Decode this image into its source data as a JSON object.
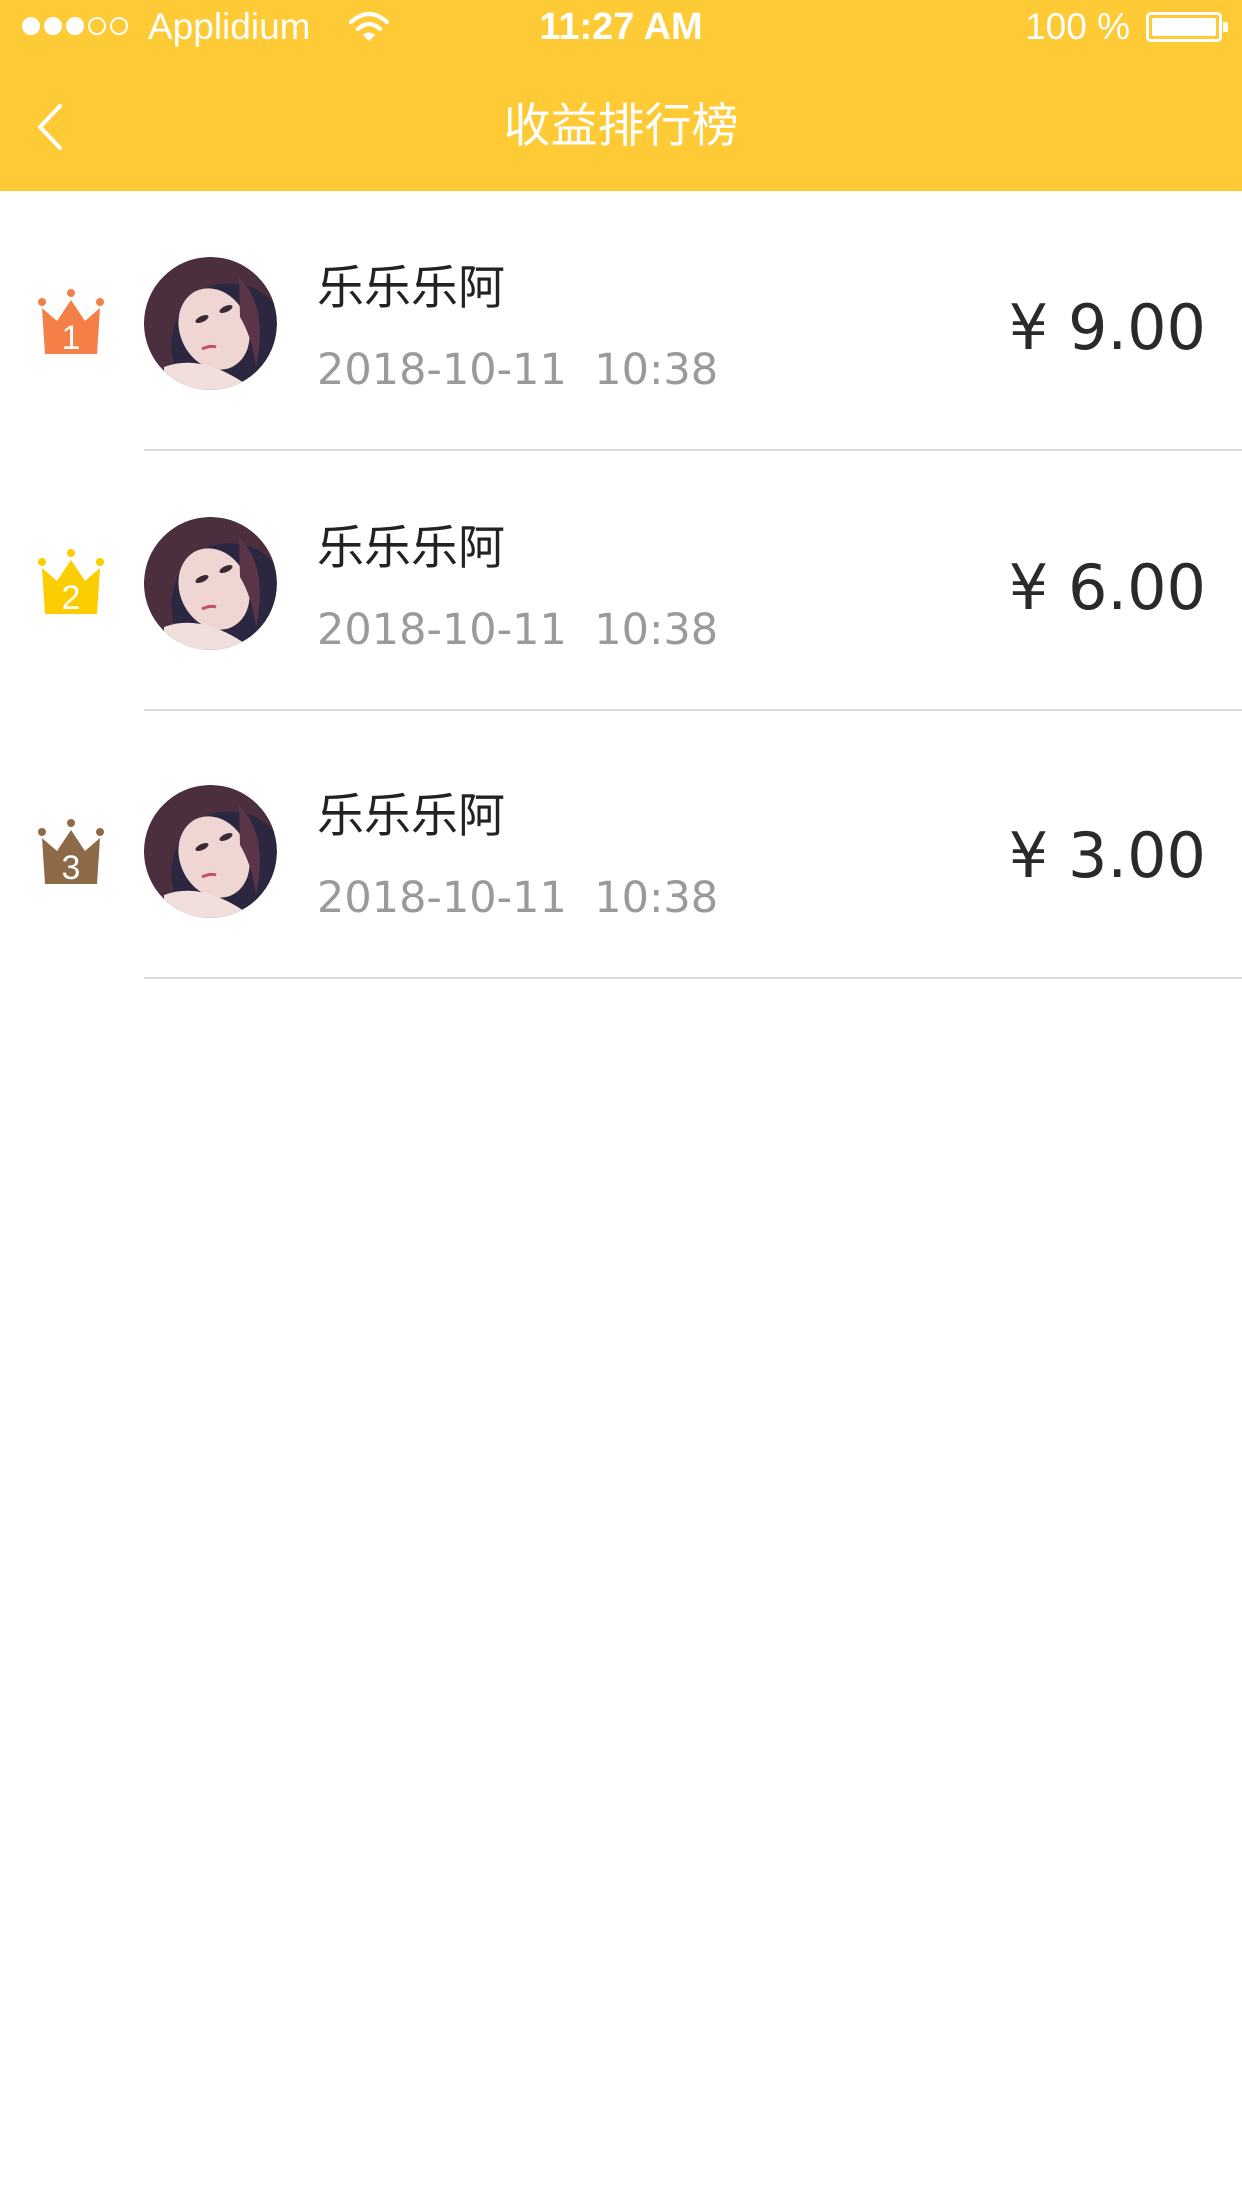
{
  "status_bar": {
    "carrier": "Applidium",
    "time": "11:27 AM",
    "battery": "100 %",
    "signal_icon": "signal-dots-icon",
    "wifi_icon": "wifi-icon",
    "battery_icon": "battery-icon"
  },
  "nav": {
    "title": "收益排行榜",
    "back_icon": "chevron-left-icon"
  },
  "colors": {
    "header": "#fecb37",
    "rank_1": "#f47f47",
    "rank_2": "#fccd00",
    "rank_3": "#8f6a48",
    "divider": "#dcdcdc"
  },
  "ranking": [
    {
      "rank": "1",
      "name": "乐乐乐阿",
      "date": "2018-10-11  10:38",
      "amount": "¥ 9.00"
    },
    {
      "rank": "2",
      "name": "乐乐乐阿",
      "date": "2018-10-11  10:38",
      "amount": "¥ 6.00"
    },
    {
      "rank": "3",
      "name": "乐乐乐阿",
      "date": "2018-10-11  10:38",
      "amount": "¥ 3.00"
    }
  ]
}
